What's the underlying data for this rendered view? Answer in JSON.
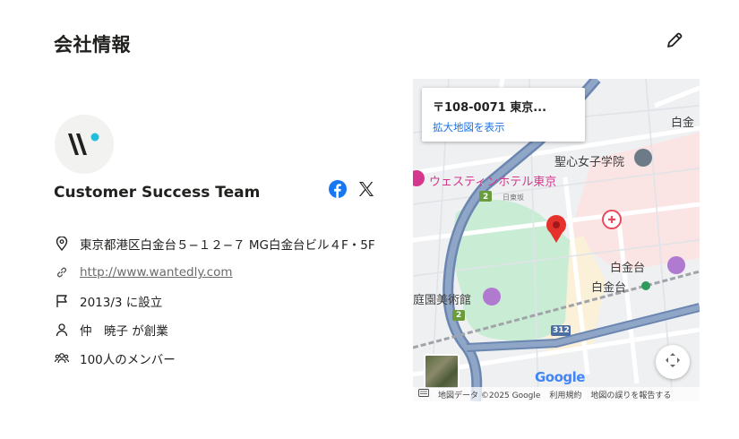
{
  "page": {
    "title": "会社情報"
  },
  "company": {
    "name": "Customer Success Team",
    "logo_text": "W"
  },
  "info": [
    {
      "icon": "location-pin-icon",
      "text": "東京都港区白金台５−１２−７ MG白金台ビル４F・5F"
    },
    {
      "icon": "link-icon",
      "text": "http://www.wantedly.com"
    },
    {
      "icon": "flag-icon",
      "text": "2013/3 に設立"
    },
    {
      "icon": "person-icon",
      "text": "仲　暁子 が創業"
    },
    {
      "icon": "people-icon",
      "text": "100人のメンバー"
    }
  ],
  "map": {
    "card_address": "〒108-0071 東京...",
    "card_link": "拡大地図を表示",
    "labels": {
      "hotel": "ウェスティンホテル東京",
      "school": "聖心女子学院",
      "museum": "庭園美術館",
      "shirokanedai1": "白金台",
      "shirokanedai2": "白金台",
      "shirokane": "白金",
      "road_nichi": "日東坂",
      "route_2a": "2",
      "route_2b": "2",
      "route_312": "312"
    },
    "google": "Google",
    "attribution": {
      "map_data": "地図データ ©2025 Google",
      "terms": "利用規約",
      "report": "地図の誤りを報告する"
    }
  },
  "colors": {
    "facebook": "#1877f2",
    "accent": "#21bddb",
    "map_park": "#c9ecd5",
    "map_road_major": "#5c7aa8",
    "map_pin": "#e5322d"
  }
}
